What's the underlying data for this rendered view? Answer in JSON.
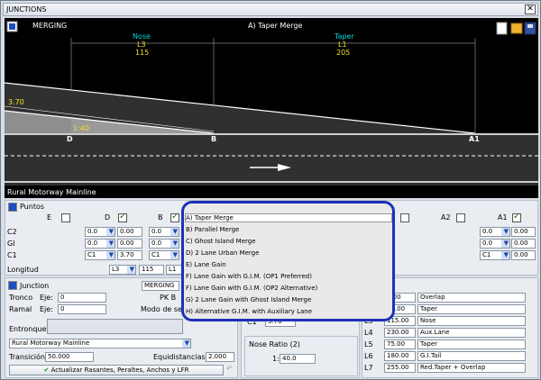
{
  "window": {
    "title": "JUNCTIONS"
  },
  "canvas": {
    "mode_label": "MERGING",
    "junction_title": "A) Taper Merge",
    "nose": {
      "label": "Nose",
      "code": "L3",
      "value": "115"
    },
    "taper": {
      "label": "Taper",
      "code": "L1",
      "value": "205"
    },
    "width_label": "3.70",
    "ratio_label": "1:40",
    "points": [
      "D",
      "B",
      "A1"
    ],
    "road_name": "Rural Motorway Mainline"
  },
  "popup": {
    "items": [
      "A) Taper Merge",
      "B) Parallel Merge",
      "C) Ghost Island Merge",
      "D) 2 Lane Urban Merge",
      "E) Lane Gain",
      "F) Lane Gain with G.I.M. (OP1 Preferred)",
      "F) Lane Gain with G.I.M. (OP2 Alternative)",
      "G) 2 Lane Gain with Ghost Island Merge",
      "H) Alternative G.I.M. with Auxiliary Lane"
    ],
    "selected_index": 0
  },
  "puntos": {
    "title": "Puntos",
    "cols": {
      "E": "E",
      "D": "D",
      "B": "B",
      "A2": "A2",
      "A1": "A1"
    },
    "row_labels": [
      "C2",
      "GI",
      "C1"
    ],
    "D": {
      "c2": "0.0",
      "c2v": "0.00",
      "gi": "0.0",
      "giv": "0.00",
      "c1": "C1",
      "c1v": "3.70"
    },
    "B": {
      "c2": "0.0",
      "gi": "0.0",
      "c1": "C1"
    },
    "A1": {
      "c2": "0.0",
      "c2v": "0.00",
      "gi": "0.0",
      "giv": "0.00",
      "c1": "C1",
      "c1v": "0.00"
    },
    "longitud_label": "Longitud",
    "long_code": "L3",
    "long_value": "115",
    "long_code2": "L1"
  },
  "junction": {
    "title": "Junction",
    "type_value": "MERGING",
    "tronco_label": "Tronco",
    "eje_label": "Eje:",
    "tronco_eje": "0",
    "ramal_label": "Ramal",
    "ramal_eje": "0",
    "pk_label": "PK B",
    "modo_label": "Modo de selec",
    "entronques_label": "Entronques",
    "mainline_select": "Rural Motorway Mainline",
    "transicion_label": "Transición",
    "transicion_value": "50.000",
    "equidistancias_label": "Equidistancias",
    "equidistancias_value": "2.000",
    "update_button": "Actualizar  Rasantes, Peraltes, Anchos y LFR"
  },
  "mid": {
    "c1_label": "C1",
    "c1_value": "3.70",
    "nose_ratio_label": "Nose Ratio (2)",
    "nose_ratio_prefix": "1:",
    "nose_ratio_value": "40.0"
  },
  "lengths": [
    {
      "code": "",
      "value": "0.00",
      "desc": "Overlap"
    },
    {
      "code": "",
      "value": "95.00",
      "desc": "Taper"
    },
    {
      "code": "L3",
      "value": "115.00",
      "desc": "Nose"
    },
    {
      "code": "L4",
      "value": "230.00",
      "desc": "Aux.Lane"
    },
    {
      "code": "L5",
      "value": "75.00",
      "desc": "Taper"
    },
    {
      "code": "L6",
      "value": "180.00",
      "desc": "G.I.Tail"
    },
    {
      "code": "L7",
      "value": "255.00",
      "desc": "Red.Taper + Overlap"
    }
  ],
  "colors": {
    "accent": "#1d31b8",
    "cyan": "#00d8d8",
    "yellow": "#f0e020"
  }
}
